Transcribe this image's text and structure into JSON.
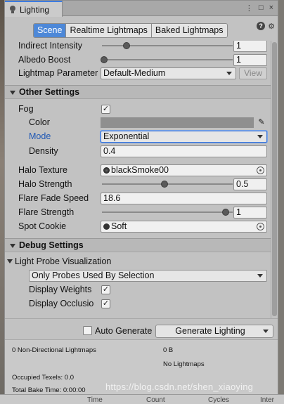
{
  "window": {
    "tab_title": "Lighting",
    "icons": [
      "menu-icon",
      "maximize-icon",
      "close-icon"
    ]
  },
  "toolbar": {
    "tabs": [
      {
        "label": "Scene",
        "active": true
      },
      {
        "label": "Realtime Lightmaps",
        "active": false
      },
      {
        "label": "Baked Lightmaps",
        "active": false
      }
    ]
  },
  "properties": {
    "indirect_intensity": {
      "label": "Indirect Intensity",
      "value": "1",
      "slider_fraction": 0.2
    },
    "albedo_boost": {
      "label": "Albedo Boost",
      "value": "1",
      "slider_fraction": 0.0
    },
    "lightmap_parameter": {
      "label": "Lightmap Parameter",
      "value": "Default-Medium",
      "view_label": "View"
    }
  },
  "other_settings": {
    "title": "Other Settings",
    "fog": {
      "label": "Fog",
      "checked": true
    },
    "color": {
      "label": "Color",
      "value_color": "#8f8f8f"
    },
    "mode": {
      "label": "Mode",
      "value": "Exponential"
    },
    "density": {
      "label": "Density",
      "value": "0.4"
    },
    "halo_texture": {
      "label": "Halo Texture",
      "value": "blackSmoke00"
    },
    "halo_strength": {
      "label": "Halo Strength",
      "value": "0.5",
      "slider_fraction": 0.5
    },
    "flare_fade_speed": {
      "label": "Flare Fade Speed",
      "value": "18.6"
    },
    "flare_strength": {
      "label": "Flare Strength",
      "value": "1",
      "slider_fraction": 1.0
    },
    "spot_cookie": {
      "label": "Spot Cookie",
      "value": "Soft"
    }
  },
  "debug_settings": {
    "title": "Debug Settings",
    "light_probe_visualization": {
      "label": "Light Probe Visualization",
      "value": "Only Probes Used By Selection"
    },
    "display_weights": {
      "label": "Display Weights",
      "checked": true
    },
    "display_occlusion": {
      "label": "Display Occlusio",
      "checked": true
    }
  },
  "bottom": {
    "auto_generate": {
      "label": "Auto Generate",
      "checked": false
    },
    "generate_button": "Generate Lighting"
  },
  "stats": {
    "lightmaps": "0 Non-Directional Lightmaps",
    "size": "0 B",
    "no_lightmaps": "No Lightmaps",
    "occupied_texels": "Occupied Texels: 0.0",
    "total_bake_time": "Total Bake Time: 0:00:00"
  },
  "background_labels": {
    "time": "Time",
    "count": "Count",
    "cycles": "Cycles",
    "inter": "Inter"
  },
  "watermark": "https://blog.csdn.net/shen_xiaoying",
  "colors": {
    "accent": "#4d88d8",
    "mode_label": "#1f58b5",
    "panel": "#c2c2c2"
  }
}
